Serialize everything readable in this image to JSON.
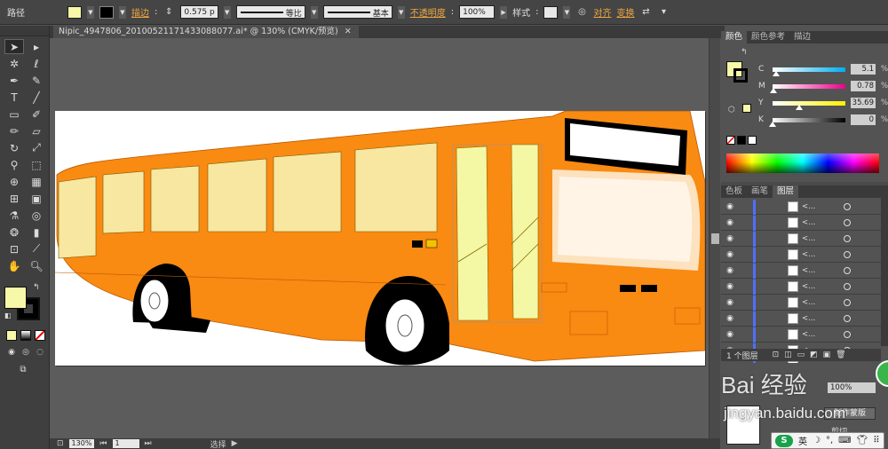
{
  "control_bar": {
    "object_type": "路径",
    "stroke_label": "描边",
    "stroke_weight": "0.575 p",
    "stroke_profile": "等比",
    "brush_profile": "基本",
    "opacity_label": "不透明度",
    "opacity_value": "100%",
    "style_label": "样式",
    "align_label": "对齐",
    "transform_label": "变换",
    "fill_color": "#f7f8a8"
  },
  "document": {
    "tab_title": "Nipic_4947806_20100521171433088077.ai* @ 130% (CMYK/预览)"
  },
  "status_bar": {
    "zoom": "130%",
    "artboard": "1",
    "tool_name": "选择"
  },
  "color_panel": {
    "tabs": [
      "颜色",
      "颜色参考",
      "描边"
    ],
    "sliders": [
      {
        "name": "C",
        "value": "5.1",
        "fraction": 0.05,
        "gradient": "linear-gradient(to right,#ffffff,#00aeef)"
      },
      {
        "name": "M",
        "value": "0.78",
        "fraction": 0.01,
        "gradient": "linear-gradient(to right,#ffffff,#ec008c)"
      },
      {
        "name": "Y",
        "value": "35.69",
        "fraction": 0.36,
        "gradient": "linear-gradient(to right,#ffffff,#fff200)"
      },
      {
        "name": "K",
        "value": "0",
        "fraction": 0.0,
        "gradient": "linear-gradient(to right,#ffffff,#000000)"
      }
    ],
    "percent": "%"
  },
  "layers_panel": {
    "tabs": [
      "色板",
      "画笔",
      "图层"
    ],
    "row_label": "<...",
    "footer": "1 个图层"
  },
  "transparency": {
    "opacity_value": "100%",
    "make_mask_button": "制作蒙版",
    "clip_label": "剪切"
  },
  "watermark": {
    "site": "jingyan.baidu.com",
    "logo_text": "Bai 经验"
  },
  "ime": {
    "lang": "英"
  },
  "colors": {
    "bus_orange": "#f98a12",
    "window_yellow": "#f7e7a0",
    "door_yellow": "#f4f7a4",
    "panel_bg": "#535353"
  }
}
